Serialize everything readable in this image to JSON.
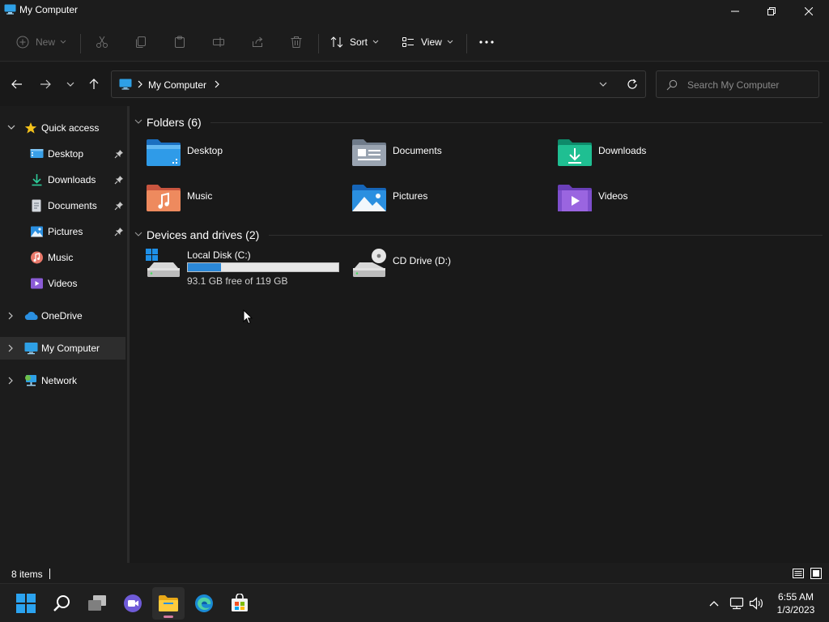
{
  "window": {
    "title": "My Computer"
  },
  "toolbar": {
    "new_label": "New",
    "sort_label": "Sort",
    "view_label": "View"
  },
  "address": {
    "crumb": "My Computer"
  },
  "search": {
    "placeholder": "Search My Computer"
  },
  "sidebar": {
    "quick_access": "Quick access",
    "items": [
      {
        "label": "Desktop",
        "pinned": true
      },
      {
        "label": "Downloads",
        "pinned": true
      },
      {
        "label": "Documents",
        "pinned": true
      },
      {
        "label": "Pictures",
        "pinned": true
      },
      {
        "label": "Music",
        "pinned": false
      },
      {
        "label": "Videos",
        "pinned": false
      }
    ],
    "onedrive": "OneDrive",
    "my_computer": "My Computer",
    "network": "Network"
  },
  "main": {
    "folders_title": "Folders (6)",
    "folders": [
      {
        "label": "Desktop",
        "icon": "desktop-folder-icon"
      },
      {
        "label": "Documents",
        "icon": "documents-folder-icon"
      },
      {
        "label": "Downloads",
        "icon": "downloads-folder-icon"
      },
      {
        "label": "Music",
        "icon": "music-folder-icon"
      },
      {
        "label": "Pictures",
        "icon": "pictures-folder-icon"
      },
      {
        "label": "Videos",
        "icon": "videos-folder-icon"
      }
    ],
    "drives_title": "Devices and drives (2)",
    "drives": [
      {
        "label": "Local Disk (C:)",
        "free_text": "93.1 GB free of 119 GB",
        "used_fraction": 0.22
      },
      {
        "label": "CD Drive (D:)"
      }
    ]
  },
  "status": {
    "item_count": "8 items"
  },
  "taskbar": {
    "time": "6:55 AM",
    "date": "1/3/2023"
  },
  "colors": {
    "accent": "#2b88d8",
    "background": "#191919"
  }
}
